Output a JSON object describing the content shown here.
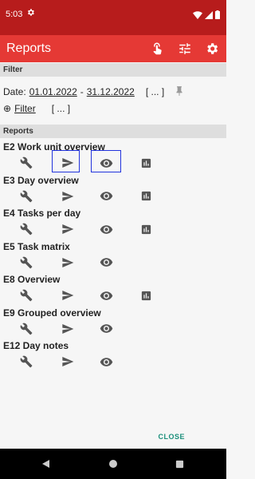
{
  "status": {
    "time": "5:03"
  },
  "app_bar": {
    "title": "Reports"
  },
  "filter": {
    "header": "Filter",
    "date_label": "Date:",
    "date_from": "01.01.2022",
    "date_sep": "-",
    "date_to": "31.12.2022",
    "date_more": "[ ... ]",
    "filter_prefix": "⊕",
    "filter_label": "Filter",
    "filter_more": "[ ... ]"
  },
  "reports": {
    "header": "Reports",
    "items": [
      {
        "label": "E2 Work unit overview",
        "has_chart": true
      },
      {
        "label": "E3 Day overview",
        "has_chart": true
      },
      {
        "label": "E4 Tasks per day",
        "has_chart": true
      },
      {
        "label": "E5 Task matrix",
        "has_chart": false
      },
      {
        "label": "E8 Overview",
        "has_chart": true
      },
      {
        "label": "E9 Grouped overview",
        "has_chart": false
      },
      {
        "label": "E12 Day notes",
        "has_chart": false
      }
    ]
  },
  "footer": {
    "close_label": "CLOSE"
  },
  "colors": {
    "status_bar": "#b71c1c",
    "app_bar": "#e53935",
    "accent": "#1a8f7a",
    "icon": "#555555"
  }
}
